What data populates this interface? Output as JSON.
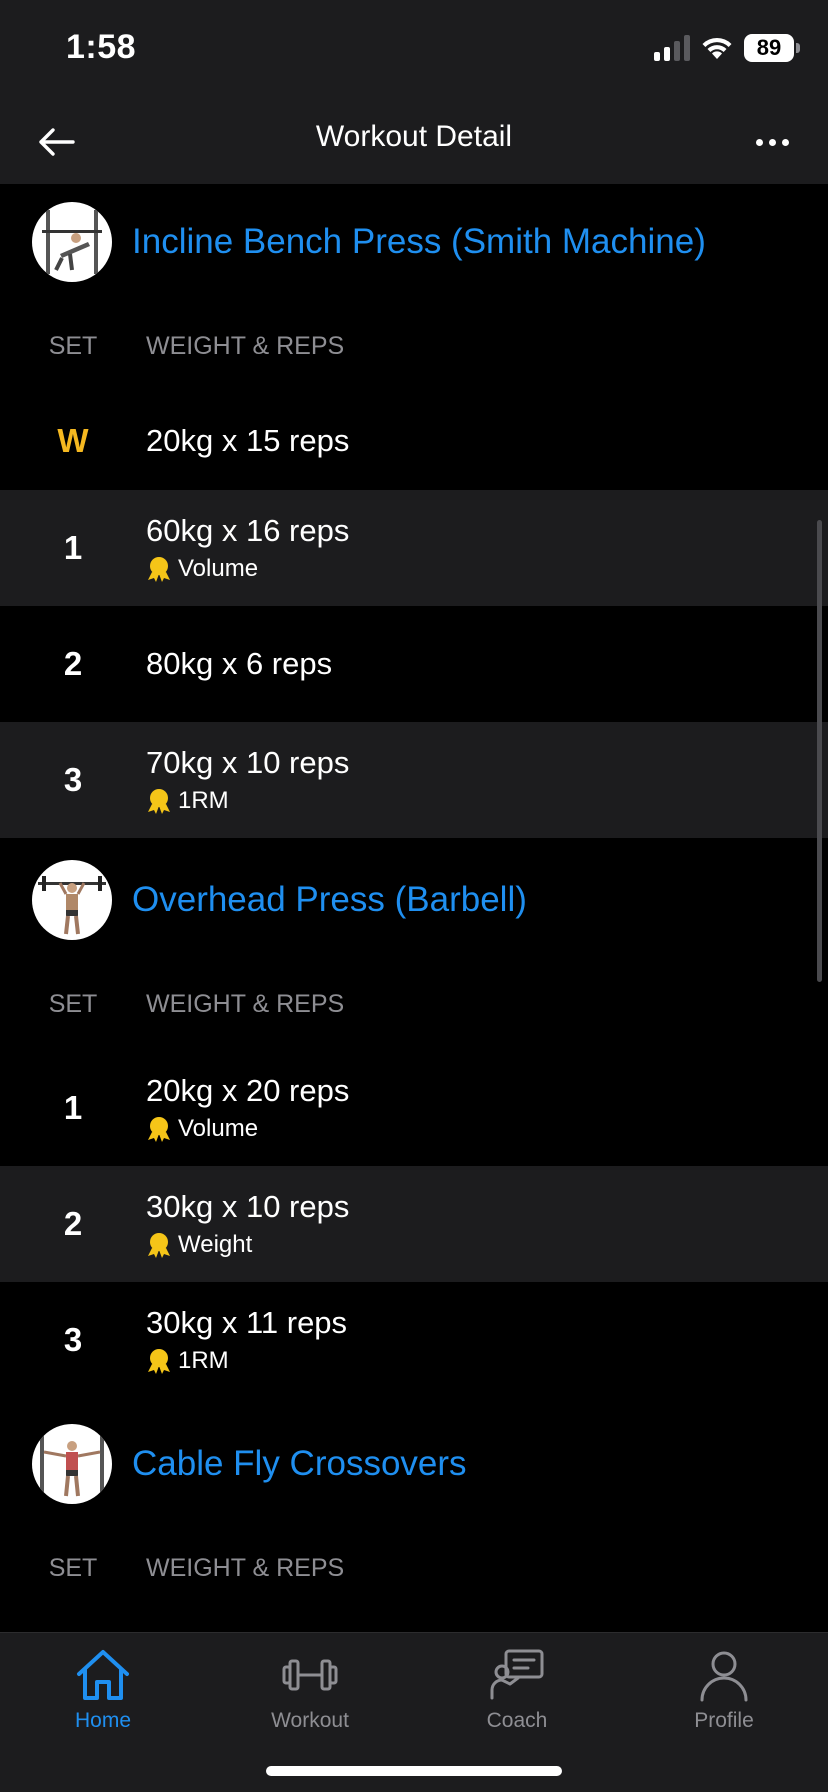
{
  "status": {
    "time": "1:58",
    "battery": "89"
  },
  "nav": {
    "title": "Workout Detail",
    "back_icon": "arrow-left-icon",
    "more_icon": "ellipsis-icon"
  },
  "exercises": [
    {
      "name": "Incline Bench Press (Smith Machine)",
      "col_set": "SET",
      "col_weight": "WEIGHT & REPS",
      "sets": [
        {
          "set": "W",
          "text": "20kg x 15 reps",
          "pr": ""
        },
        {
          "set": "1",
          "text": "60kg x 16 reps",
          "pr": "Volume"
        },
        {
          "set": "2",
          "text": "80kg x 6 reps",
          "pr": ""
        },
        {
          "set": "3",
          "text": "70kg x 10 reps",
          "pr": "1RM"
        }
      ]
    },
    {
      "name": "Overhead Press (Barbell)",
      "col_set": "SET",
      "col_weight": "WEIGHT & REPS",
      "sets": [
        {
          "set": "1",
          "text": "20kg x 20 reps",
          "pr": "Volume"
        },
        {
          "set": "2",
          "text": "30kg x 10 reps",
          "pr": "Weight"
        },
        {
          "set": "3",
          "text": "30kg x 11 reps",
          "pr": "1RM"
        }
      ]
    },
    {
      "name": "Cable Fly Crossovers",
      "col_set": "SET",
      "col_weight": "WEIGHT & REPS"
    }
  ],
  "tabs": [
    {
      "label": "Home",
      "icon": "home-icon",
      "active": true
    },
    {
      "label": "Workout",
      "icon": "dumbbell-icon",
      "active": false
    },
    {
      "label": "Coach",
      "icon": "coach-icon",
      "active": false
    },
    {
      "label": "Profile",
      "icon": "profile-icon",
      "active": false
    }
  ],
  "colors": {
    "accent": "#1f8ff0",
    "warmup": "#f5b820",
    "medal": "#f5c518",
    "background": "#000000",
    "surface": "#1c1c1e"
  }
}
